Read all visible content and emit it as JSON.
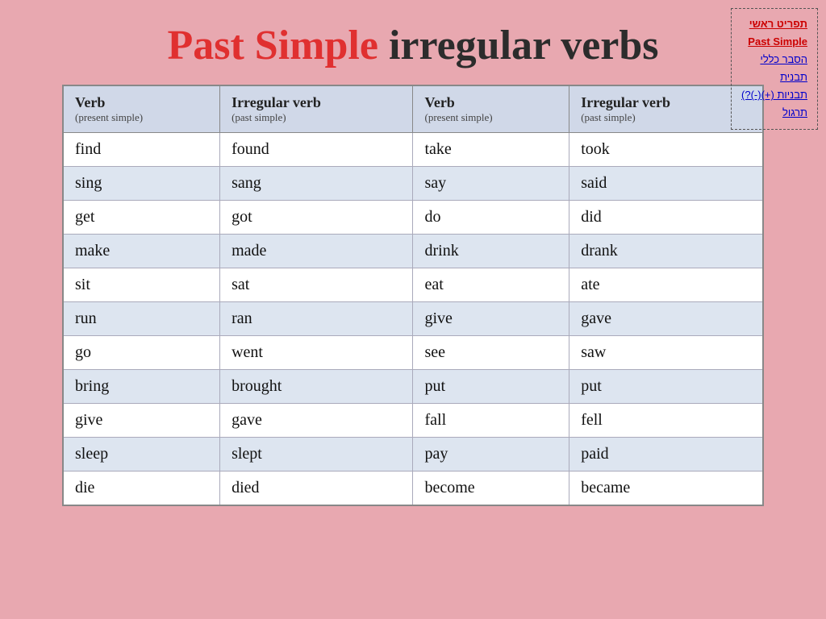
{
  "nav": {
    "items": [
      {
        "label": "תפריט ראשי",
        "class": "main",
        "active": false
      },
      {
        "label": "Past Simple",
        "class": "link",
        "active": true
      },
      {
        "label": "הסבר כללי",
        "class": "link",
        "active": false
      },
      {
        "label": "תבנית",
        "class": "link",
        "active": false
      },
      {
        "label": "תבניות (+)(-)(?)",
        "class": "link",
        "active": false
      },
      {
        "label": "תרגול",
        "class": "link",
        "active": false
      }
    ]
  },
  "title": {
    "part1": "Past Simple",
    "part2": "irregular verbs"
  },
  "table": {
    "headers": [
      {
        "main": "Verb",
        "sub": "(present simple)"
      },
      {
        "main": "Irregular verb",
        "sub": "(past simple)"
      },
      {
        "main": "Verb",
        "sub": "(present simple)"
      },
      {
        "main": "Irregular verb",
        "sub": "(past simple)"
      }
    ],
    "rows": [
      [
        "find",
        "found",
        "take",
        "took"
      ],
      [
        "sing",
        "sang",
        "say",
        "said"
      ],
      [
        "get",
        "got",
        "do",
        "did"
      ],
      [
        "make",
        "made",
        "drink",
        "drank"
      ],
      [
        "sit",
        "sat",
        "eat",
        "ate"
      ],
      [
        "run",
        "ran",
        "give",
        "gave"
      ],
      [
        "go",
        "went",
        "see",
        "saw"
      ],
      [
        "bring",
        "brought",
        "put",
        "put"
      ],
      [
        "give",
        "gave",
        "fall",
        "fell"
      ],
      [
        "sleep",
        "slept",
        "pay",
        "paid"
      ],
      [
        "die",
        "died",
        "become",
        "became"
      ]
    ]
  }
}
